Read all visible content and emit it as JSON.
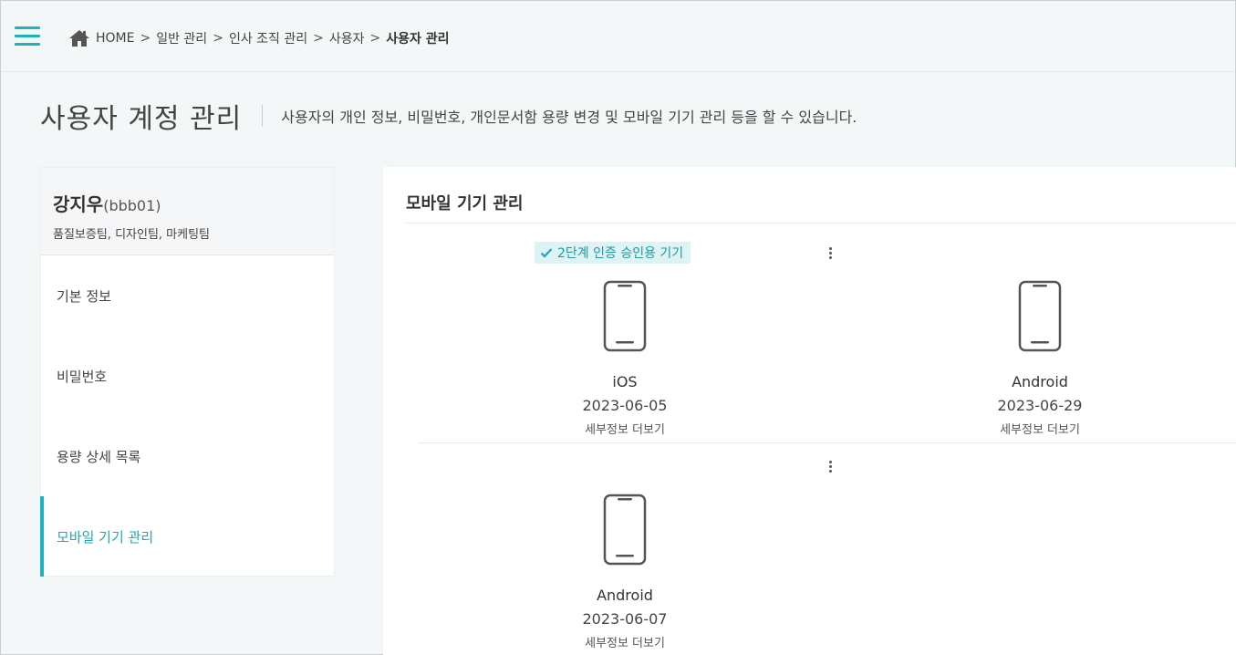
{
  "breadcrumb": {
    "home": "HOME",
    "items": [
      "일반 관리",
      "인사 조직 관리",
      "사용자"
    ],
    "current": "사용자 관리",
    "separator": ">"
  },
  "page": {
    "title": "사용자 계정 관리",
    "description": "사용자의 개인 정보, 비밀번호, 개인문서함 용량 변경 및 모바일 기기 관리 등을 할 수 있습니다."
  },
  "user": {
    "name": "강지우",
    "id": "(bbb01)",
    "teams": "품질보증팀, 디자인팀, 마케팅팀"
  },
  "menu": [
    {
      "label": "기본 정보",
      "active": false
    },
    {
      "label": "비밀번호",
      "active": false
    },
    {
      "label": "용량 상세 목록",
      "active": false
    },
    {
      "label": "모바일 기기 관리",
      "active": true
    }
  ],
  "main": {
    "title": "모바일 기기 관리",
    "badge": "2단계 인증 승인용 기기",
    "devices": [
      {
        "os": "iOS",
        "date": "2023-06-05",
        "more": "세부정보 더보기"
      },
      {
        "os": "Android",
        "date": "2023-06-29",
        "more": "세부정보 더보기"
      },
      {
        "os": "Android",
        "date": "2023-06-07",
        "more": "세부정보 더보기"
      }
    ]
  },
  "colors": {
    "accent": "#1fb3bb",
    "badge_bg": "#dff3f4",
    "background": "#f4f7f8"
  },
  "icons": {
    "menu": "hamburger-icon",
    "home": "home-icon",
    "check": "check-icon",
    "options": "kebab-icon",
    "device": "smartphone-icon"
  }
}
